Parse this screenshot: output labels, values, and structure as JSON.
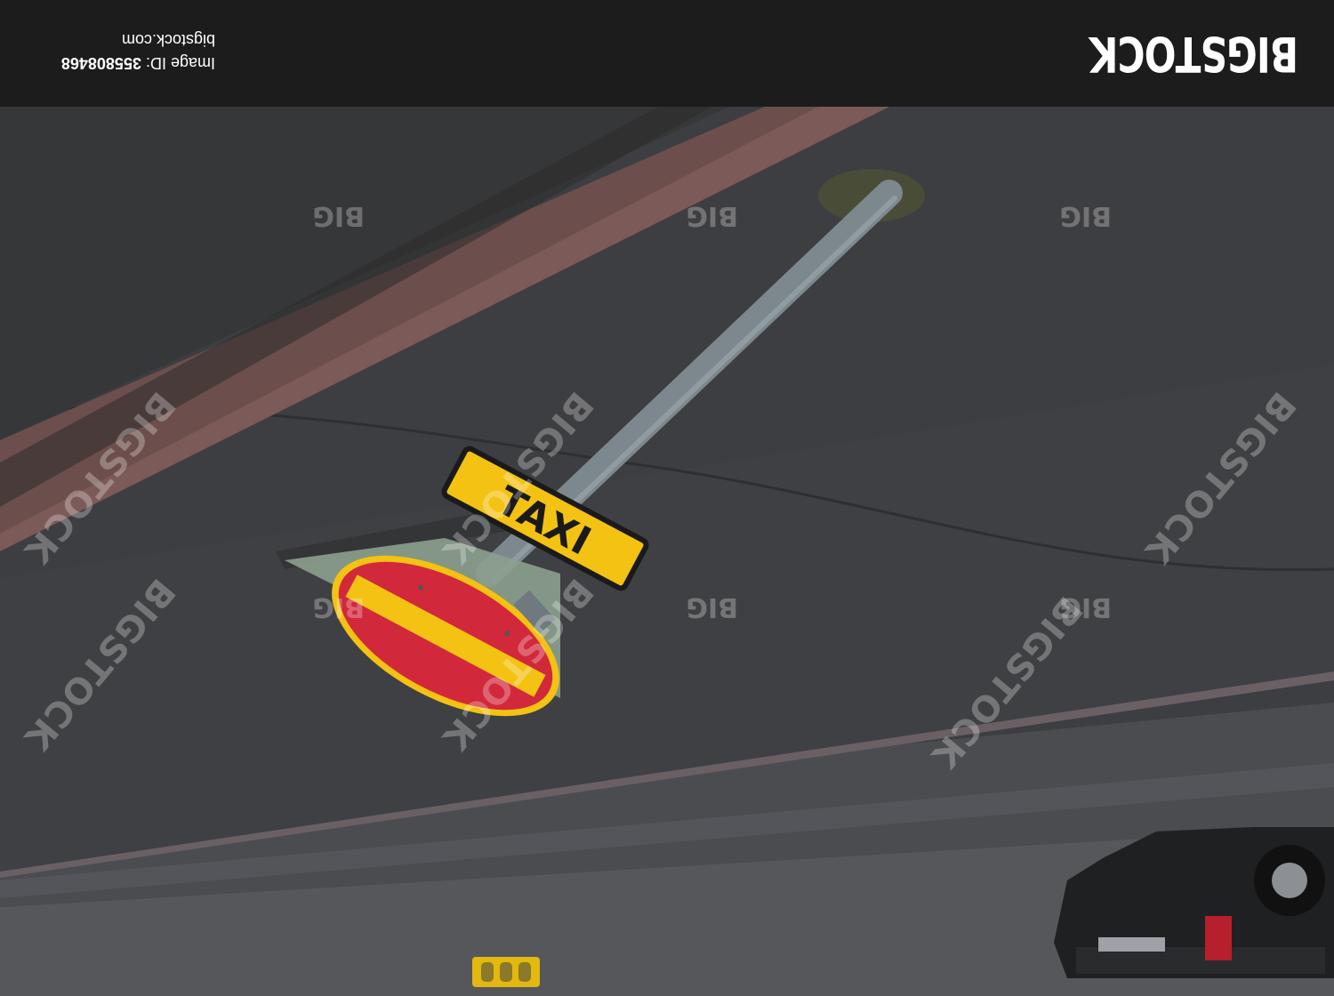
{
  "brand": {
    "logo_text": "BIGSTOCK"
  },
  "meta": {
    "id_label": "Image ID:",
    "id_value": "355808468",
    "site": "bigstock.com"
  },
  "watermark": {
    "big_text": "BIGSTOCK",
    "small_text": "BIG"
  },
  "sign": {
    "plate_text": "TAXI"
  },
  "colors": {
    "asphalt": "#3e3f42",
    "sign_red": "#d2283c",
    "sign_yellow": "#f3c212",
    "pole": "#8a979c",
    "footer": "#1c1c1c"
  }
}
